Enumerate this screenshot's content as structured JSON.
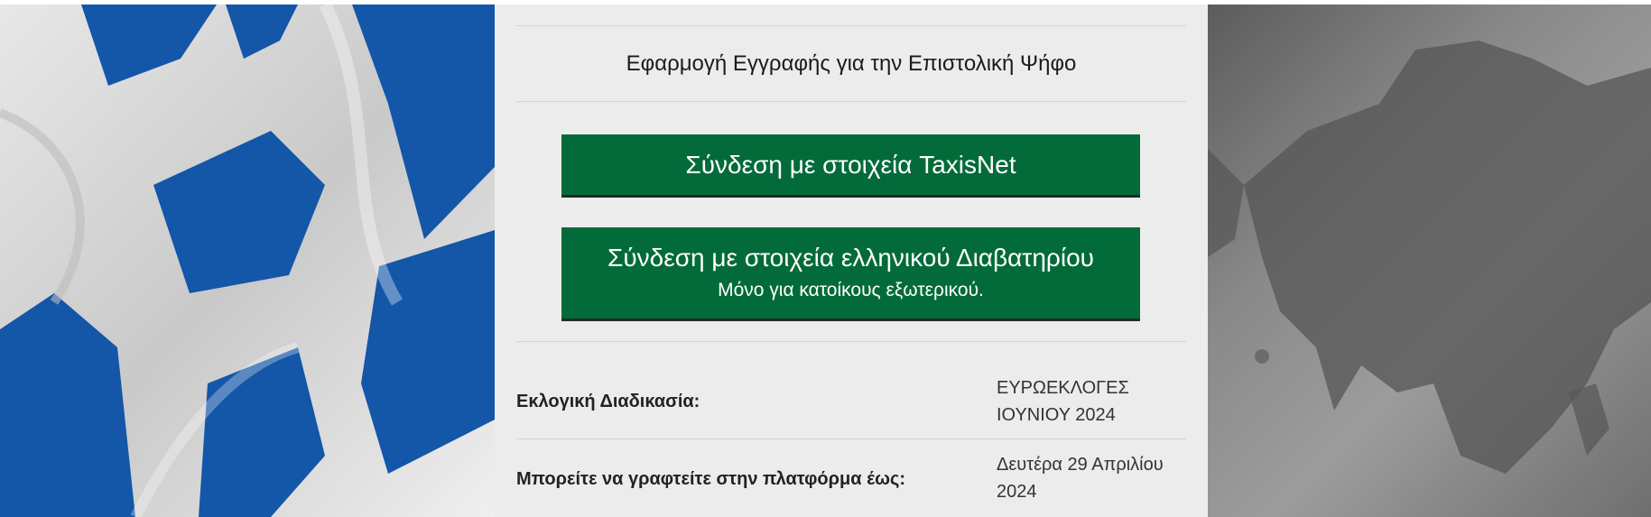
{
  "app_title": "Εφαρμογή Εγγραφής για την Επιστολική Ψήφο",
  "buttons": {
    "taxisnet": "Σύνδεση με στοιχεία TaxisNet",
    "passport": "Σύνδεση με στοιχεία ελληνικού Διαβατηρίου",
    "passport_note": "Μόνο για κατοίκους εξωτερικού."
  },
  "info": {
    "process_label": "Εκλογική Διαδικασία:",
    "process_value_line1": "ΕΥΡΩΕΚΛΟΓΕΣ",
    "process_value_line2": "ΙΟΥΝΙΟΥ 2024",
    "deadline_label": "Μπορείτε να γραφτείτε στην πλατφόρμα έως:",
    "deadline_value_line1": "Δευτέρα 29 Απριλίου",
    "deadline_value_line2": "2024"
  },
  "colors": {
    "button_green": "#036b3a",
    "flag_blue": "#1456a8",
    "panel_bg": "#ececec"
  }
}
